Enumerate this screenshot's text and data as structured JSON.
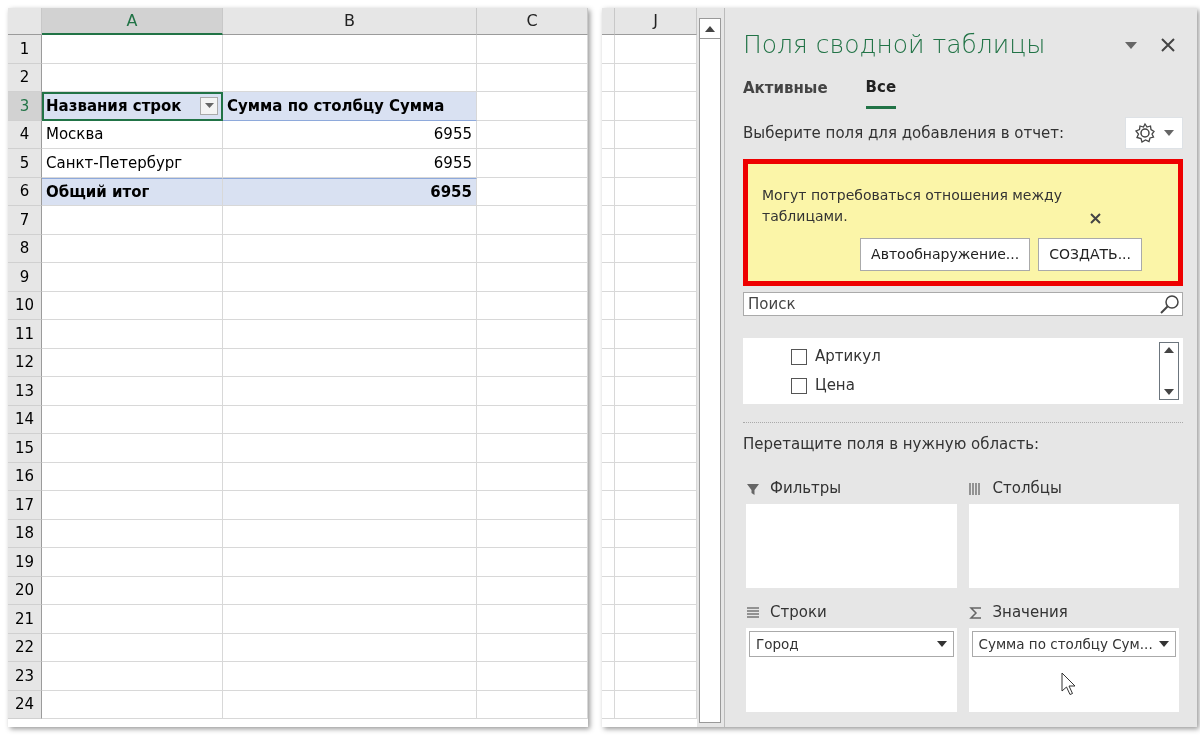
{
  "sheet": {
    "columns": [
      {
        "label": "A",
        "selected": true
      },
      {
        "label": "B",
        "selected": false
      },
      {
        "label": "C",
        "selected": false
      }
    ],
    "rows": [
      {
        "number": "1",
        "selected": false,
        "kind": "blank"
      },
      {
        "number": "2",
        "selected": false,
        "kind": "blank"
      },
      {
        "number": "3",
        "selected": true,
        "kind": "pivot-header",
        "label": "Названия строк",
        "value": "Сумма по столбцу Сумма"
      },
      {
        "number": "4",
        "selected": false,
        "kind": "item",
        "label": "Москва",
        "value": "6955"
      },
      {
        "number": "5",
        "selected": false,
        "kind": "item",
        "label": "Санкт-Петербург",
        "value": "6955"
      },
      {
        "number": "6",
        "selected": false,
        "kind": "total",
        "label": "Общий итог",
        "value": "6955"
      },
      {
        "number": "7",
        "selected": false,
        "kind": "blank"
      },
      {
        "number": "8",
        "selected": false,
        "kind": "blank"
      },
      {
        "number": "9",
        "selected": false,
        "kind": "blank"
      },
      {
        "number": "10",
        "selected": false,
        "kind": "blank"
      },
      {
        "number": "11",
        "selected": false,
        "kind": "blank"
      },
      {
        "number": "12",
        "selected": false,
        "kind": "blank"
      },
      {
        "number": "13",
        "selected": false,
        "kind": "blank"
      },
      {
        "number": "14",
        "selected": false,
        "kind": "blank"
      },
      {
        "number": "15",
        "selected": false,
        "kind": "blank"
      },
      {
        "number": "16",
        "selected": false,
        "kind": "blank"
      },
      {
        "number": "17",
        "selected": false,
        "kind": "blank"
      },
      {
        "number": "18",
        "selected": false,
        "kind": "blank"
      },
      {
        "number": "19",
        "selected": false,
        "kind": "blank"
      },
      {
        "number": "20",
        "selected": false,
        "kind": "blank"
      },
      {
        "number": "21",
        "selected": false,
        "kind": "blank"
      },
      {
        "number": "22",
        "selected": false,
        "kind": "blank"
      },
      {
        "number": "23",
        "selected": false,
        "kind": "blank"
      },
      {
        "number": "24",
        "selected": false,
        "kind": "blank"
      }
    ]
  },
  "right_sheet": {
    "column": "J"
  },
  "panel": {
    "title": "Поля сводной таблицы",
    "tabs": [
      {
        "label": "Активные",
        "selected": false
      },
      {
        "label": "Все",
        "selected": true
      }
    ],
    "prompt": "Выберите поля для добавления в отчет:",
    "notice": {
      "text": "Могут потребоваться отношения между таблицами.",
      "buttons": [
        "Автообнаружение...",
        "СОЗДАТЬ..."
      ]
    },
    "search": {
      "placeholder": "Поиск"
    },
    "fields": [
      {
        "label": "Артикул",
        "checked": false
      },
      {
        "label": "Цена",
        "checked": false
      }
    ],
    "drag_hint": "Перетащите поля в нужную область:",
    "areas": [
      {
        "kind": "filters",
        "name": "Фильтры"
      },
      {
        "kind": "columns",
        "name": "Столбцы"
      },
      {
        "kind": "rows",
        "name": "Строки",
        "items": [
          "Город"
        ]
      },
      {
        "kind": "values",
        "name": "Значения",
        "items": [
          "Сумма по столбцу Сум..."
        ]
      }
    ]
  }
}
